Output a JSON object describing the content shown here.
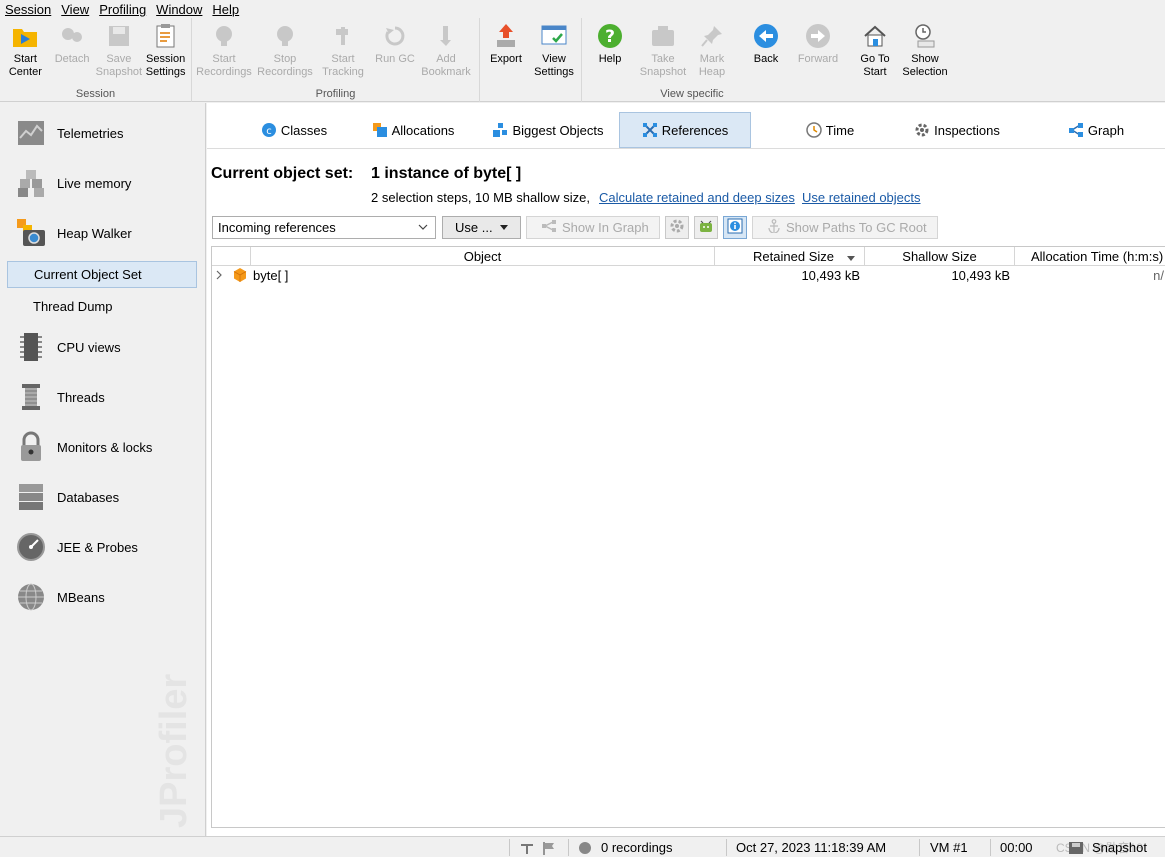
{
  "menu": [
    "Session",
    "View",
    "Profiling",
    "Window",
    "Help"
  ],
  "toolbar": {
    "groups": [
      {
        "label": "Session",
        "buttons": [
          {
            "label": "Start\nCenter",
            "icon": "start-center-icon",
            "enabled": true
          },
          {
            "label": "Detach",
            "icon": "detach-icon",
            "enabled": false
          },
          {
            "label": "Save\nSnapshot",
            "icon": "save-snapshot-icon",
            "enabled": false
          },
          {
            "label": "Session\nSettings",
            "icon": "session-settings-icon",
            "enabled": true
          }
        ]
      },
      {
        "label": "Profiling",
        "buttons": [
          {
            "label": "Start\nRecordings",
            "icon": "start-recordings-icon",
            "enabled": false
          },
          {
            "label": "Stop\nRecordings",
            "icon": "stop-recordings-icon",
            "enabled": false
          },
          {
            "label": "Start\nTracking",
            "icon": "start-tracking-icon",
            "enabled": false
          },
          {
            "label": "Run GC",
            "icon": "run-gc-icon",
            "enabled": false
          },
          {
            "label": "Add\nBookmark",
            "icon": "add-bookmark-icon",
            "enabled": false
          }
        ]
      },
      {
        "label": "",
        "buttons": [
          {
            "label": "Export",
            "icon": "export-icon",
            "enabled": true
          },
          {
            "label": "View\nSettings",
            "icon": "view-settings-icon",
            "enabled": true
          }
        ]
      },
      {
        "label": "View specific",
        "buttons": [
          {
            "label": "Help",
            "icon": "help-icon",
            "enabled": true
          },
          {
            "label": "Take\nSnapshot",
            "icon": "take-snapshot-icon",
            "enabled": false
          },
          {
            "label": "Mark\nHeap",
            "icon": "mark-heap-icon",
            "enabled": false
          },
          {
            "label": "Back",
            "icon": "back-icon",
            "enabled": true
          },
          {
            "label": "Forward",
            "icon": "forward-icon",
            "enabled": false
          },
          {
            "label": "Go To\nStart",
            "icon": "go-to-start-icon",
            "enabled": true
          },
          {
            "label": "Show\nSelection",
            "icon": "show-selection-icon",
            "enabled": true
          }
        ]
      }
    ]
  },
  "sidebar": {
    "items": [
      {
        "label": "Telemetries",
        "icon": "telemetries-icon"
      },
      {
        "label": "Live memory",
        "icon": "live-memory-icon"
      },
      {
        "label": "Heap Walker",
        "icon": "heap-walker-icon"
      },
      {
        "label": "CPU views",
        "icon": "cpu-views-icon"
      },
      {
        "label": "Threads",
        "icon": "threads-icon"
      },
      {
        "label": "Monitors & locks",
        "icon": "monitors-locks-icon"
      },
      {
        "label": "Databases",
        "icon": "databases-icon"
      },
      {
        "label": "JEE & Probes",
        "icon": "jee-probes-icon"
      },
      {
        "label": "MBeans",
        "icon": "mbeans-icon"
      }
    ],
    "sub_items": [
      {
        "label": "Current Object Set",
        "selected": true
      },
      {
        "label": "Thread Dump",
        "selected": false
      }
    ],
    "brand": "JProfiler"
  },
  "view_tabs": [
    {
      "label": "Classes",
      "icon": "classes-icon",
      "active": false
    },
    {
      "label": "Allocations",
      "icon": "allocations-icon",
      "active": false
    },
    {
      "label": "Biggest Objects",
      "icon": "biggest-objects-icon",
      "active": false
    },
    {
      "label": "References",
      "icon": "references-icon",
      "active": true
    },
    {
      "label": "Time",
      "icon": "time-icon",
      "active": false
    },
    {
      "label": "Inspections",
      "icon": "inspections-icon",
      "active": false
    },
    {
      "label": "Graph",
      "icon": "graph-icon",
      "active": false
    }
  ],
  "object_set": {
    "title": "Current object set:",
    "value": "1 instance of byte[ ]",
    "info": "2 selection steps, 10 MB shallow size,",
    "link_calculate": "Calculate retained and deep sizes",
    "link_use_retained": "Use retained objects"
  },
  "controls": {
    "reference_mode": "Incoming references",
    "use_label": "Use ...",
    "show_in_graph": "Show In Graph",
    "show_paths": "Show Paths To GC Root"
  },
  "table": {
    "columns": [
      "Object",
      "Retained Size",
      "Shallow Size",
      "Allocation Time (h:m:s)"
    ],
    "rows": [
      {
        "object": "byte[ ]",
        "retained": "10,493 kB",
        "shallow": "10,493 kB",
        "alloc_time": "n/"
      }
    ]
  },
  "status": {
    "recordings": "0 recordings",
    "datetime": "Oct 27, 2023 11:18:39 AM",
    "vm": "VM #1",
    "elapsed": "00:00",
    "mode": "Snapshot",
    "watermark": "CSDN @勋音18"
  },
  "colors": {
    "accent_selection": "#dbe8f5",
    "link": "#1a5aa6",
    "disabled_text": "#aaaaaa"
  }
}
